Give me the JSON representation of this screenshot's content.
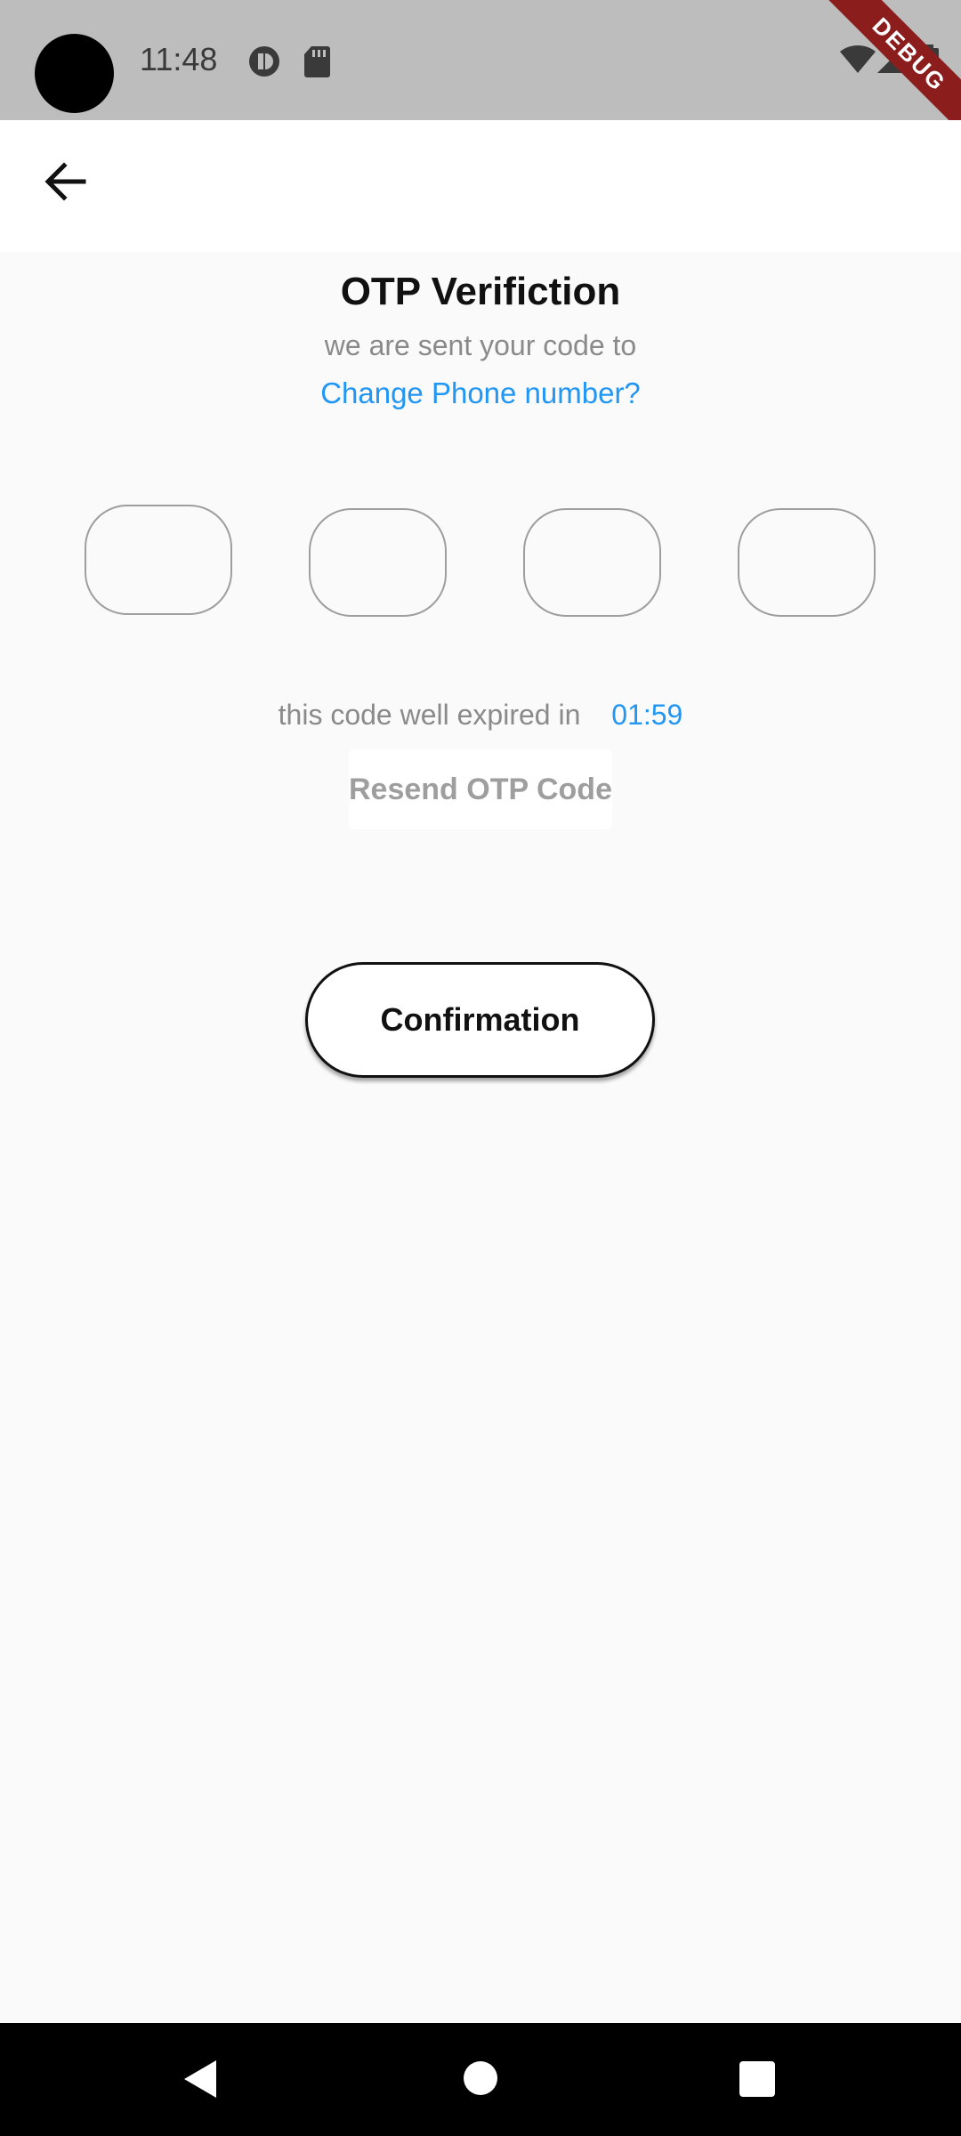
{
  "status_bar": {
    "time": "11:48",
    "debug_label": "DEBUG",
    "icons": [
      "data-saver-icon",
      "sd-card-icon",
      "wifi-icon",
      "signal-icon",
      "battery-icon"
    ]
  },
  "app_bar": {
    "back_icon": "arrow-left-icon"
  },
  "otp": {
    "title": "OTP Verifiction",
    "subtitle": "we are sent your code to",
    "change_phone": "Change Phone number?",
    "digits": [
      "",
      "",
      "",
      ""
    ],
    "timer_label": "this code well expired in",
    "timer_value": "01:59",
    "resend_label": "Resend OTP Code",
    "confirm_label": "Confirmation"
  },
  "nav_bar": {
    "icons": [
      "back-triangle-icon",
      "home-circle-icon",
      "recents-square-icon"
    ]
  },
  "colors": {
    "accent": "#2196f3",
    "status_bar": "#bdbdbd",
    "background": "#fafafa",
    "debug_ribbon": "#8b1d1d"
  }
}
